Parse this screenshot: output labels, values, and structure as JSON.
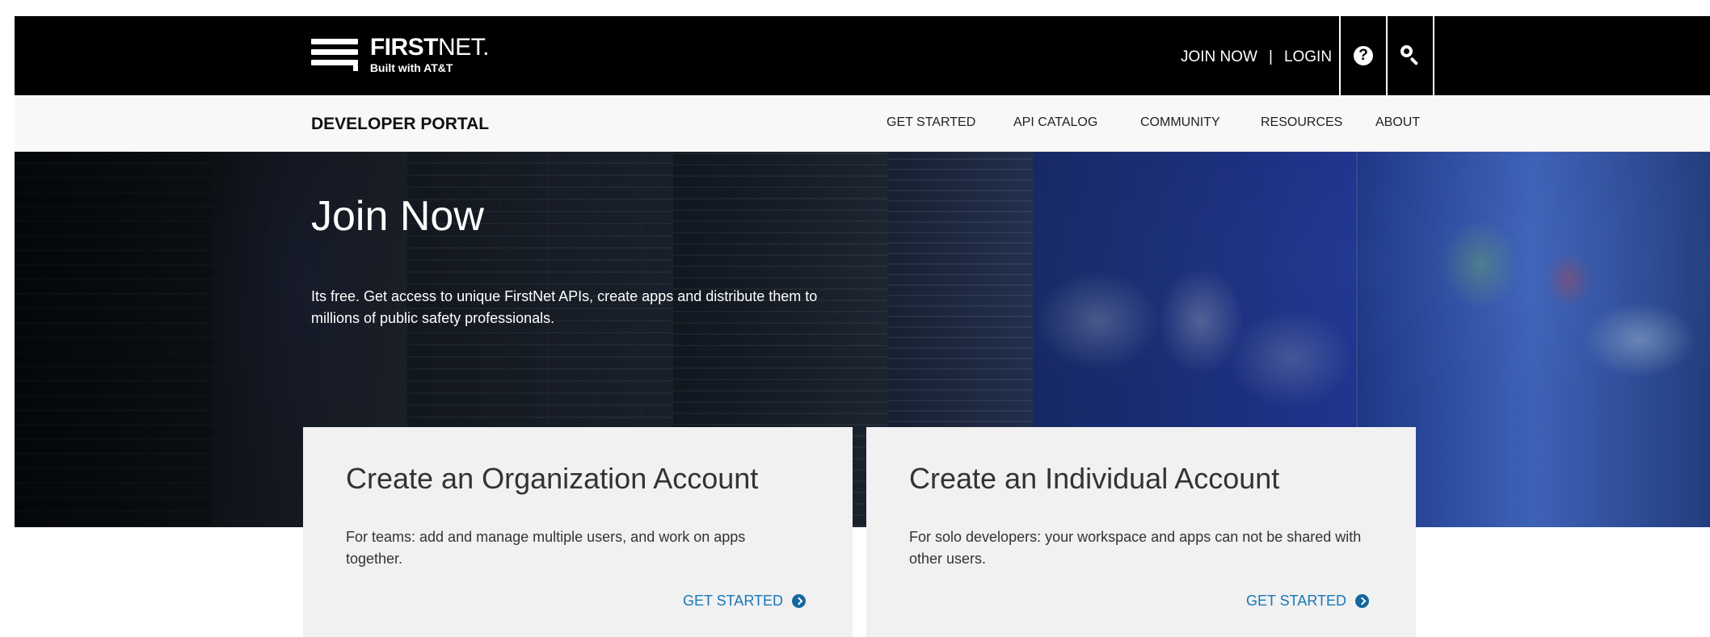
{
  "header": {
    "logo": {
      "primary": "FIRST",
      "secondary": "NET.",
      "subtitle": "Built with AT&T"
    },
    "links": {
      "join_now": "JOIN NOW",
      "separator": "|",
      "login": "LOGIN"
    },
    "icons": {
      "help": "help-circle-icon",
      "search": "search-icon"
    }
  },
  "subnav": {
    "title": "DEVELOPER PORTAL",
    "items": [
      "GET STARTED",
      "API CATALOG",
      "COMMUNITY",
      "RESOURCES",
      "ABOUT"
    ]
  },
  "hero": {
    "title": "Join Now",
    "description": "Its free. Get access to unique FirstNet APIs, create apps and distribute them to millions of public safety professionals."
  },
  "cards": [
    {
      "title": "Create an Organization Account",
      "description": "For teams: add and manage multiple users, and work on apps together.",
      "action": "GET STARTED",
      "icon": "chevron-right-circle-icon"
    },
    {
      "title": "Create an Individual Account",
      "description": "For solo developers: your workspace and apps can not be shared with other users.",
      "action": "GET STARTED",
      "icon": "chevron-right-circle-icon"
    }
  ],
  "colors": {
    "header_bg": "#000000",
    "subnav_bg": "#f8f8f8",
    "card_bg": "#f1f1f1",
    "accent": "#1878b8"
  }
}
